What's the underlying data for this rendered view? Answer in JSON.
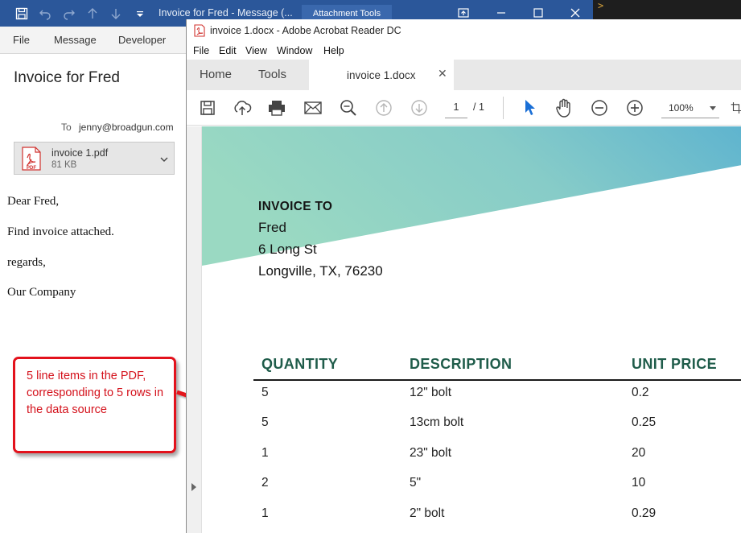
{
  "outlook": {
    "window_title": "Invoice for Fred  -  Message (...",
    "contextual_tab": "Attachment Tools",
    "menu": [
      "File",
      "Message",
      "Developer"
    ],
    "message": {
      "subject": "Invoice for Fred",
      "to_label": "To",
      "to_value": "jenny@broadgun.com",
      "attachment": {
        "name": "invoice 1.pdf",
        "size": "81 KB",
        "icon_label": "PDF"
      },
      "body": [
        "Dear Fred,",
        "Find invoice attached.",
        "regards,",
        "Our Company"
      ]
    }
  },
  "callout": {
    "text": "5 line items in the PDF, corresponding to 5 rows in the data source"
  },
  "acrobat": {
    "title": "invoice 1.docx - Adobe Acrobat Reader DC",
    "menu": [
      "File",
      "Edit",
      "View",
      "Window",
      "Help"
    ],
    "tabs": {
      "home": "Home",
      "tools": "Tools",
      "doc": "invoice 1.docx"
    },
    "toolbar": {
      "page_current": "1",
      "page_total": "/ 1",
      "zoom": "100%"
    }
  },
  "invoice": {
    "invoice_to_label": "INVOICE TO",
    "address": [
      "Fred",
      "6 Long St",
      "Longville, TX, 76230"
    ],
    "columns": [
      "QUANTITY",
      "DESCRIPTION",
      "UNIT PRICE"
    ],
    "rows": [
      {
        "qty": "5",
        "desc": "12\" bolt",
        "price": "0.2"
      },
      {
        "qty": "5",
        "desc": "13cm bolt",
        "price": "0.25"
      },
      {
        "qty": "1",
        "desc": "23\" bolt",
        "price": "20"
      },
      {
        "qty": "2",
        "desc": "5\"",
        "price": "10"
      },
      {
        "qty": "1",
        "desc": "2\" bolt",
        "price": "0.29"
      }
    ]
  },
  "colors": {
    "outlook_blue": "#2b579a",
    "header_green": "#1f5c4a",
    "callout_red": "#e3121c",
    "banner_gradient": [
      "#9ad9c2",
      "#5fb4cf"
    ]
  }
}
